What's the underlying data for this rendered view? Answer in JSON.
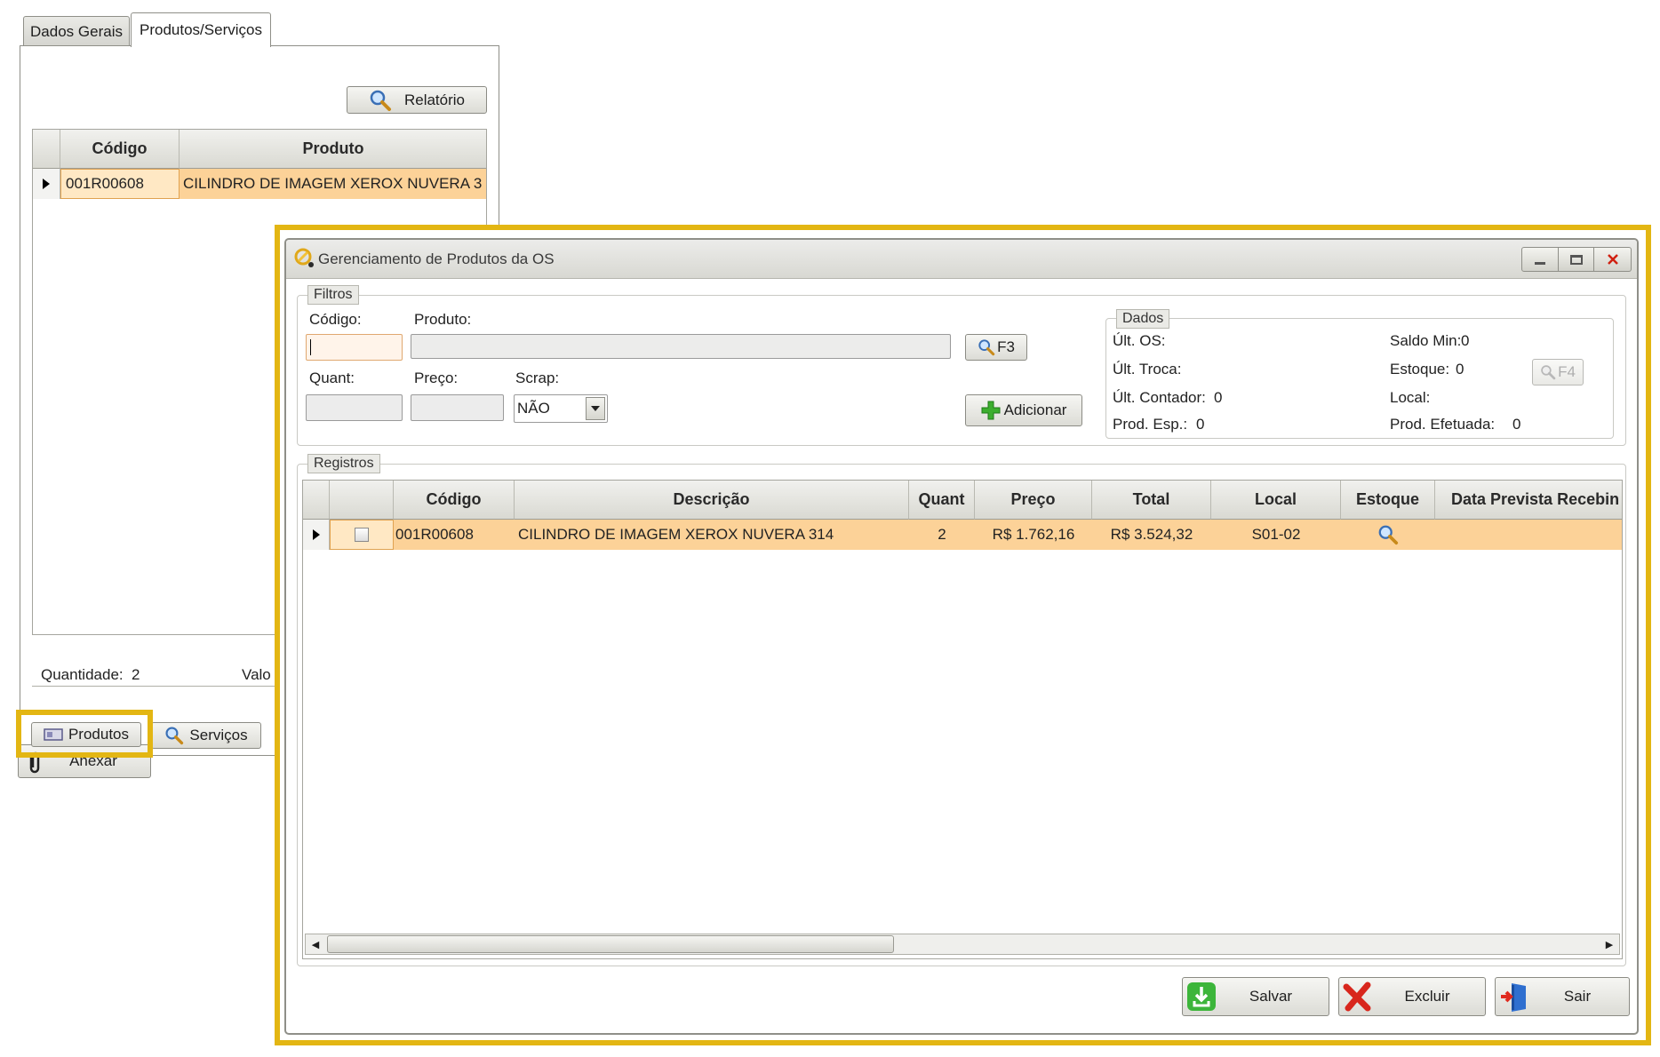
{
  "background_window": {
    "tabs": [
      {
        "label": "Dados Gerais"
      },
      {
        "label": "Produtos/Serviços"
      }
    ],
    "report_button": "Relatório",
    "grid": {
      "columns": [
        "Código",
        "Produto"
      ],
      "rows": [
        {
          "codigo": "001R00608",
          "produto": "CILINDRO DE IMAGEM XEROX NUVERA 3"
        }
      ]
    },
    "quantity_label": "Quantidade:",
    "quantity_value": "2",
    "value_label_partial": "Valo",
    "products_button": "Produtos",
    "services_button": "Serviços",
    "attach_button": "Anexar"
  },
  "dialog": {
    "title": "Gerenciamento de Produtos da OS",
    "filters": {
      "legend": "Filtros",
      "codigo_label": "Código:",
      "produto_label": "Produto:",
      "f3_button": "F3",
      "quant_label": "Quant:",
      "preco_label": "Preço:",
      "scrap_label": "Scrap:",
      "scrap_value": "NÃO",
      "add_button": "Adicionar"
    },
    "dados": {
      "legend": "Dados",
      "ult_os_label": "Últ. OS:",
      "ult_troca_label": "Últ. Troca:",
      "ult_contador_label": "Últ. Contador:",
      "ult_contador_value": "0",
      "prod_esp_label": "Prod. Esp.:",
      "prod_esp_value": "0",
      "saldo_min_label": "Saldo Min:",
      "saldo_min_value": "0",
      "estoque_label": "Estoque:",
      "estoque_value": "0",
      "local_label": "Local:",
      "prod_efetuada_label": "Prod. Efetuada:",
      "prod_efetuada_value": "0",
      "f4_button": "F4"
    },
    "registros": {
      "legend": "Registros",
      "columns": [
        "Código",
        "Descrição",
        "Quant",
        "Preço",
        "Total",
        "Local",
        "Estoque",
        "Data Prevista Recebin"
      ],
      "rows": [
        {
          "codigo": "001R00608",
          "descricao": "CILINDRO DE IMAGEM XEROX NUVERA 314",
          "quant": "2",
          "preco": "R$ 1.762,16",
          "total": "R$ 3.524,32",
          "local": "S01-02"
        }
      ]
    },
    "buttons": {
      "save": "Salvar",
      "delete": "Excluir",
      "exit": "Sair"
    }
  },
  "colors": {
    "highlight": "#e3b613",
    "selected_row": "#fcd298",
    "title_bar": "#e1e1db",
    "close_x": "#d02010"
  }
}
